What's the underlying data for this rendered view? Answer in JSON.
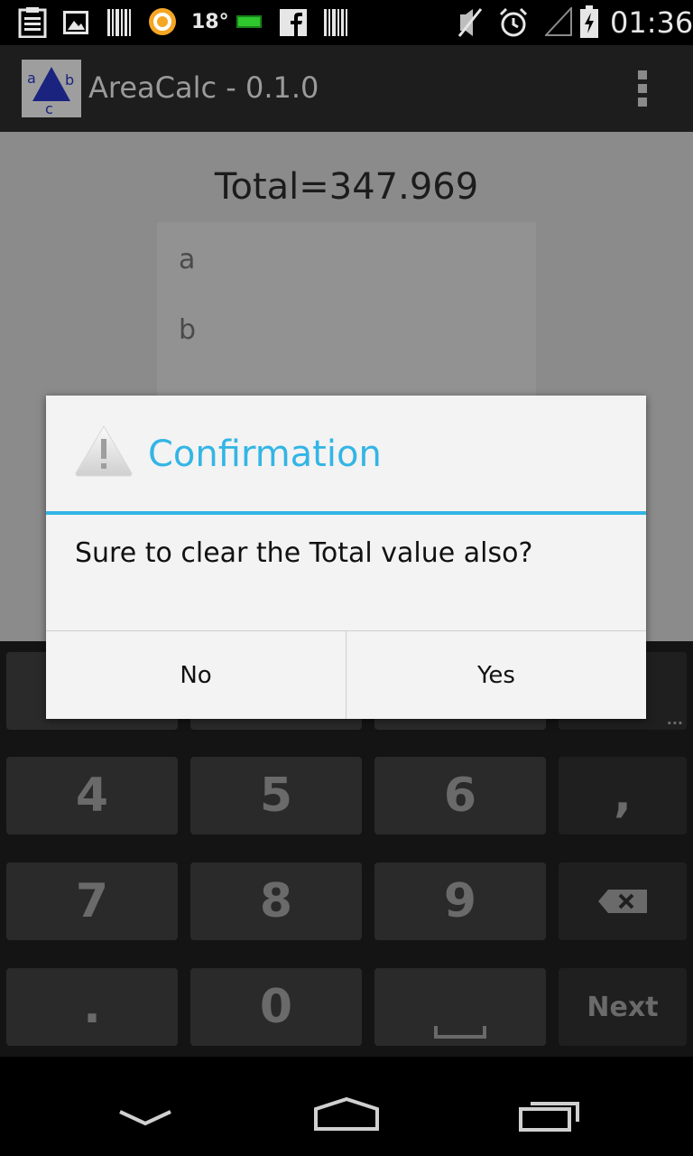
{
  "status_bar": {
    "temperature": "18°",
    "time": "01:36",
    "icons": [
      "clipboard-icon",
      "image-icon",
      "barcode-icon",
      "app-o-icon",
      "battery-green-icon",
      "facebook-icon",
      "barcode-icon",
      "mute-icon",
      "alarm-icon",
      "signal-icon",
      "battery-charging-icon"
    ]
  },
  "app_bar": {
    "logo_letters": {
      "a": "a",
      "b": "b",
      "c": "c"
    },
    "title": "AreaCalc - 0.1.0",
    "overflow_icon": "overflow-menu-icon"
  },
  "content": {
    "total": "Total=347.969",
    "fields": [
      "a",
      "b"
    ]
  },
  "keyboard": {
    "keys_row1": [
      "",
      "",
      "",
      ""
    ],
    "keys_row2": [
      "4",
      "5",
      "6",
      ","
    ],
    "keys_row3": [
      "7",
      "8",
      "9",
      ""
    ],
    "keys_row4": [
      ".",
      "0",
      "",
      "Next"
    ],
    "more_indicator": "..."
  },
  "dialog": {
    "title": "Confirmation",
    "icon": "warning-icon",
    "message": "Sure to clear the Total value also?",
    "negative_button": "No",
    "positive_button": "Yes",
    "accent_color": "#33b5e5"
  },
  "nav_bar": {
    "icons": [
      "back-icon",
      "home-icon",
      "recents-icon"
    ]
  }
}
